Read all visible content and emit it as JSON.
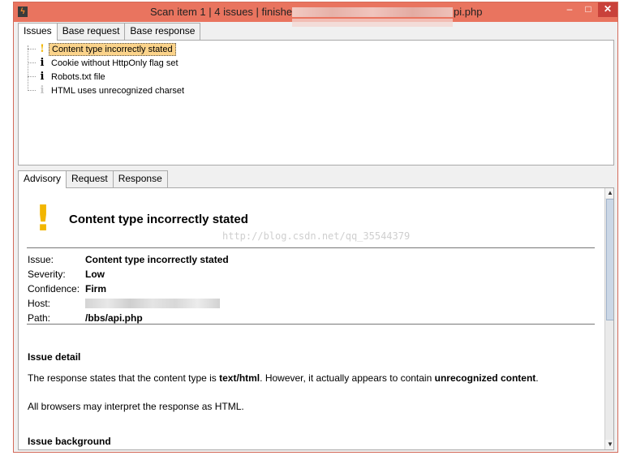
{
  "window": {
    "title_prefix": "Scan item 1 | 4 issues | finished",
    "title_suffix": "pi.php",
    "minimize_glyph": "–",
    "maximize_glyph": "□",
    "close_glyph": "✕"
  },
  "top_tabs": [
    {
      "label": "Issues",
      "active": true
    },
    {
      "label": "Base request",
      "active": false
    },
    {
      "label": "Base response",
      "active": false
    }
  ],
  "issues": [
    {
      "icon": "warning-icon",
      "glyph": "!",
      "label": "Content type incorrectly stated",
      "selected": true
    },
    {
      "icon": "info-icon",
      "glyph": "i",
      "label": "Cookie without HttpOnly flag set",
      "selected": false
    },
    {
      "icon": "info-icon",
      "glyph": "i",
      "label": "Robots.txt file",
      "selected": false
    },
    {
      "icon": "info-light-icon",
      "glyph": "i",
      "label": "HTML uses unrecognized charset",
      "selected": false
    }
  ],
  "detail_tabs": [
    {
      "label": "Advisory",
      "active": true
    },
    {
      "label": "Request",
      "active": false
    },
    {
      "label": "Response",
      "active": false
    }
  ],
  "advisory": {
    "heading": "Content type incorrectly stated",
    "watermark": "http://blog.csdn.net/qq_35544379",
    "fields": {
      "issue_label": "Issue:",
      "issue_value": "Content type incorrectly stated",
      "severity_label": "Severity:",
      "severity_value": "Low",
      "confidence_label": "Confidence:",
      "confidence_value": "Firm",
      "host_label": "Host:",
      "path_label": "Path:",
      "path_value": "/bbs/api.php"
    },
    "issue_detail_title": "Issue detail",
    "detail_p1_a": "The response states that the content type is ",
    "detail_p1_b": "text/html",
    "detail_p1_c": ". However, it actually appears to contain ",
    "detail_p1_d": "unrecognized content",
    "detail_p1_e": ".",
    "detail_p2": "All browsers may interpret the response as HTML.",
    "issue_background_title": "Issue background"
  },
  "colors": {
    "titlebar": "#e9745f",
    "selected_item": "#fbd38a",
    "warning": "#f2b600"
  }
}
